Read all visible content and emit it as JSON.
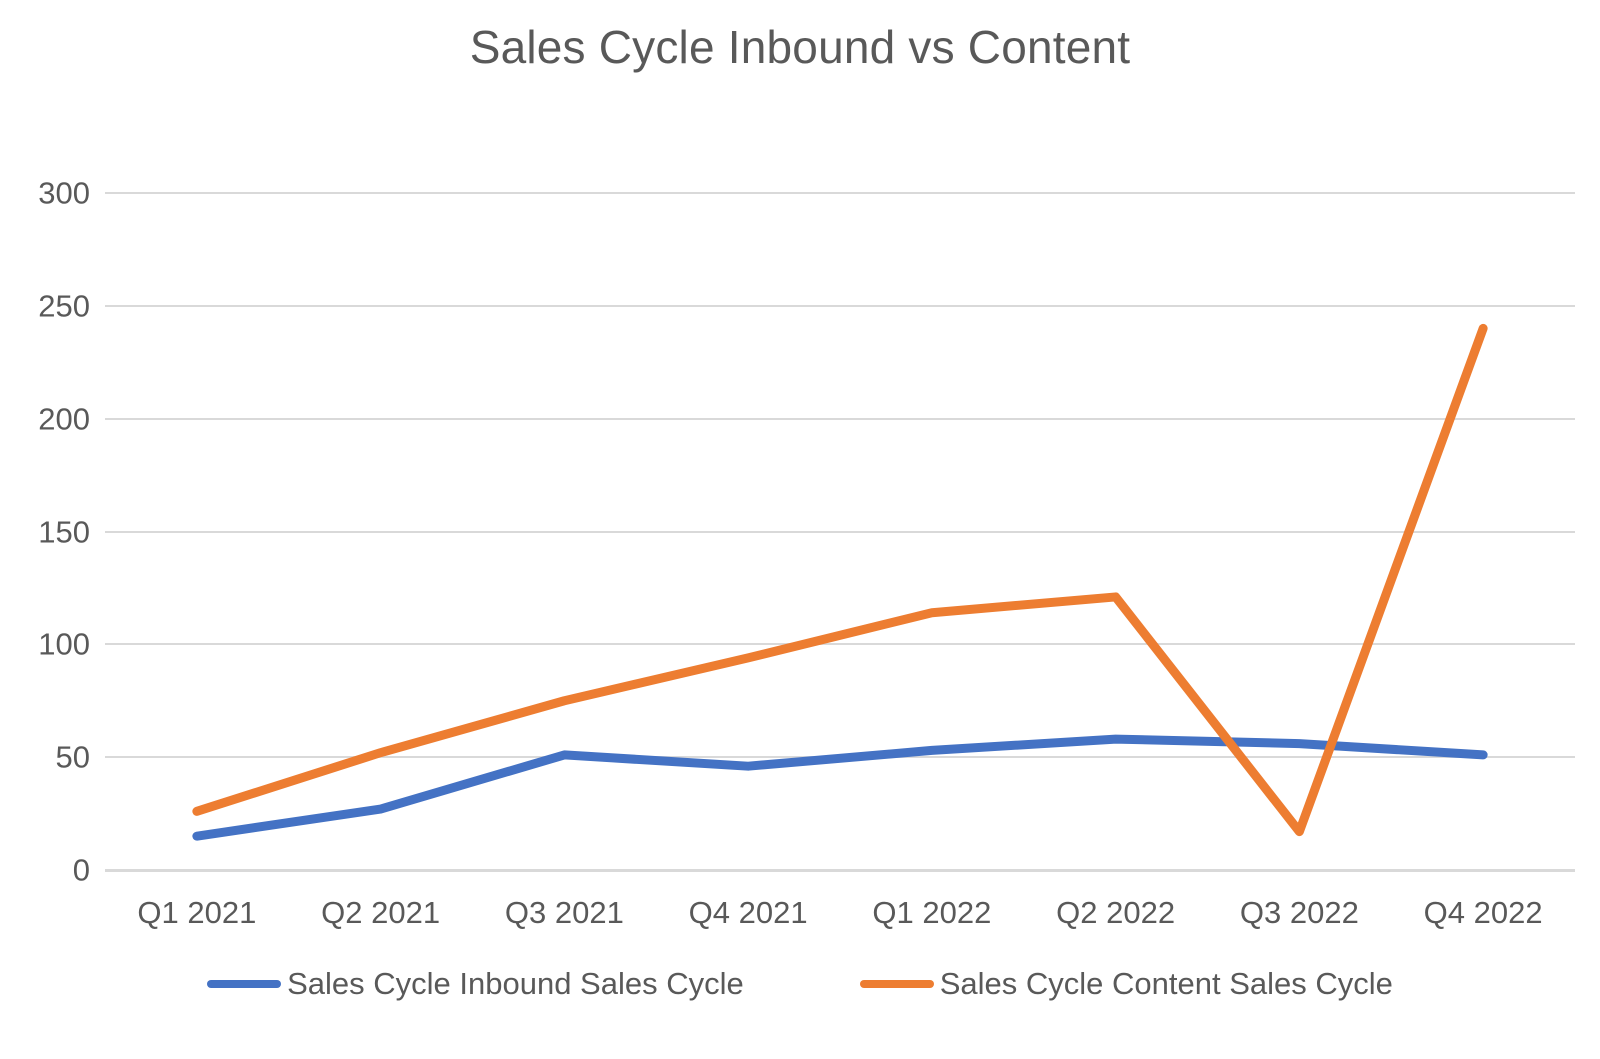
{
  "chart_data": {
    "type": "line",
    "title": "Sales Cycle Inbound vs Content",
    "xlabel": "",
    "ylabel": "",
    "categories": [
      "Q1 2021",
      "Q2 2021",
      "Q3 2021",
      "Q4 2021",
      "Q1 2022",
      "Q2 2022",
      "Q3 2022",
      "Q4 2022"
    ],
    "series": [
      {
        "name": "Sales Cycle Inbound Sales Cycle",
        "color": "#4472C4",
        "values": [
          15,
          27,
          51,
          46,
          53,
          58,
          56,
          51
        ]
      },
      {
        "name": "Sales Cycle Content Sales Cycle",
        "color": "#ED7D31",
        "values": [
          26,
          52,
          75,
          94,
          114,
          121,
          17,
          240
        ]
      }
    ],
    "ylim": [
      0,
      300
    ],
    "yticks": [
      0,
      50,
      100,
      150,
      200,
      250,
      300
    ],
    "ytick_labels": [
      "0",
      "50",
      "100",
      "150",
      "200",
      "250",
      "300"
    ],
    "grid": true,
    "legend_position": "bottom"
  },
  "legend": {
    "items": [
      {
        "label": "Sales Cycle Inbound Sales Cycle",
        "color": "#4472C4"
      },
      {
        "label": "Sales Cycle Content Sales Cycle",
        "color": "#ED7D31"
      }
    ]
  },
  "colors": {
    "series_blue": "#4472C4",
    "series_orange": "#ED7D31",
    "gridline": "#D9D9D9",
    "text": "#595959",
    "background": "#FFFFFF"
  }
}
